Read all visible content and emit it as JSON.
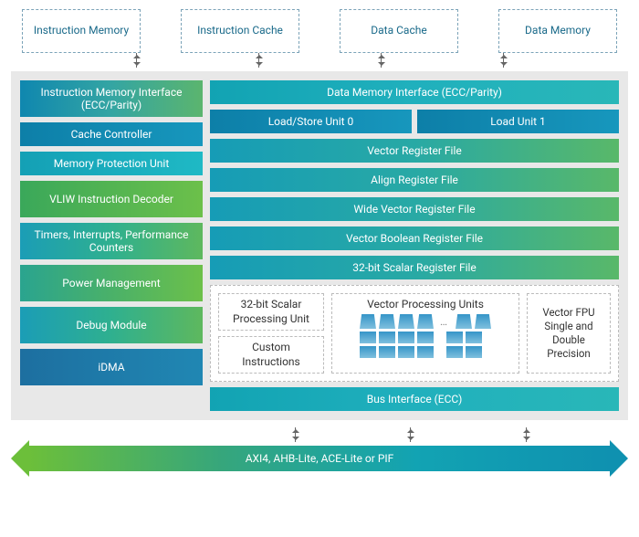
{
  "top": [
    "Instruction Memory",
    "Instruction Cache",
    "Data Cache",
    "Data Memory"
  ],
  "left": {
    "im_interface": "Instruction Memory Interface (ECC/Parity)",
    "cache_ctrl": "Cache Controller",
    "mpu": "Memory Protection Unit",
    "vliw": "VLIW Instruction Decoder",
    "timers": "Timers, Interrupts, Performance Counters",
    "power": "Power Management",
    "debug": "Debug Module",
    "idma": "iDMA"
  },
  "right": {
    "dm_interface": "Data Memory Interface (ECC/Parity)",
    "lsu0": "Load/Store Unit 0",
    "lsu1": "Load Unit 1",
    "vec_reg": "Vector Register File",
    "align_reg": "Align Register File",
    "wide_vec_reg": "Wide Vector Register File",
    "vec_bool_reg": "Vector Boolean Register File",
    "scalar_reg": "32-bit Scalar Register File",
    "scalar_pu": "32-bit Scalar Processing Unit",
    "custom": "Custom Instructions",
    "vpu_title": "Vector Processing Units",
    "fpu": "Vector FPU Single and Double Precision",
    "bus": "Bus Interface (ECC)"
  },
  "bus_protocols": "AXI4, AHB-Lite, ACE-Lite or PIF"
}
